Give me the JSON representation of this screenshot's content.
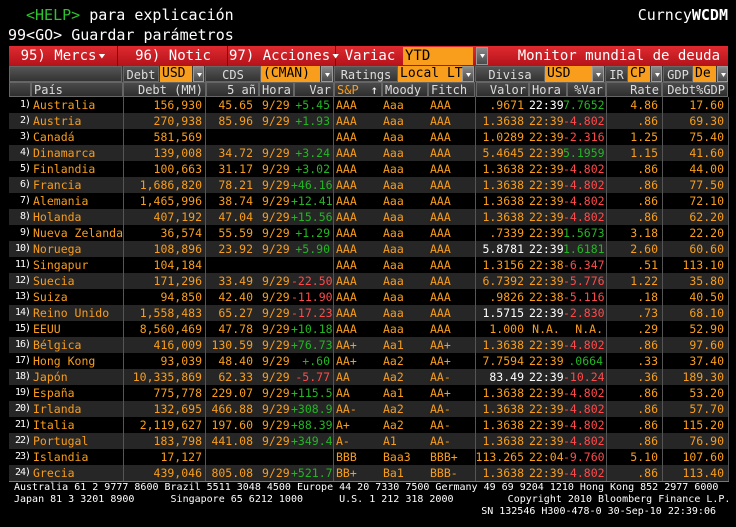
{
  "header": {
    "help_key": "<HELP>",
    "help_text": " para explicación",
    "save_line": "99<GO> Guardar parámetros",
    "function_prefix": "Curncy",
    "function_code": "WCDM"
  },
  "toolbar": {
    "mercs": "95) Mercs",
    "notic": "96) Notic",
    "acciones": "97) Acciones",
    "variac_label": "Variac",
    "variac_value": "YTD",
    "title": "Monitor mundial de deuda"
  },
  "filters": {
    "debt_label": "Debt",
    "debt_value": "USD",
    "cds_label": "CDS",
    "cds_value": "(CMAN)",
    "ratings_label": "Ratings",
    "ratings_value": "Local LT",
    "divisa_label": "Divisa",
    "divisa_value": "USD",
    "ir_label": "IR",
    "ir_value": "CP",
    "gdp_label": "GDP",
    "gdp_value": "De"
  },
  "columns": {
    "pais": "País",
    "debt": "Debt (MM)",
    "cds": "5 añ",
    "hora": "Hora",
    "var": "Var",
    "sp": "S&P",
    "sort_arrow": "↑",
    "moody": "Moody",
    "fitch": "Fitch",
    "valor": "Valor",
    "hora2": "Hora",
    "pvar": "%Var",
    "rate": "Rate",
    "gdp": "Debt%GDP"
  },
  "colors": {
    "orange": "#f99d1c",
    "green": "#22b622",
    "red": "#ff4a4a",
    "white": "#ffffff",
    "accent_red": "#d01c24"
  },
  "rows": [
    {
      "n": "1)",
      "country": "Australia",
      "debt": "156,930",
      "cds": "45.65",
      "hora": "9/29",
      "var": "+5.45",
      "sp": "AAA",
      "moody": "Aaa",
      "fitch": "AAA",
      "valor": ".9671",
      "hora2": "22:39",
      "pvar": "7.7652",
      "rate": "4.86",
      "gdp": "17.60",
      "valor_color": "#f99d1c",
      "hora2_color": "#ffffff"
    },
    {
      "n": "2)",
      "country": "Austria",
      "debt": "270,938",
      "cds": "85.96",
      "hora": "9/29",
      "var": "+1.93",
      "sp": "AAA",
      "moody": "Aaa",
      "fitch": "AAA",
      "valor": "1.3638",
      "hora2": "22:39",
      "pvar": "-4.802",
      "rate": ".86",
      "gdp": "69.30"
    },
    {
      "n": "3)",
      "country": "Canadá",
      "debt": "581,569",
      "cds": "",
      "hora": "",
      "var": "",
      "sp": "AAA",
      "moody": "Aaa",
      "fitch": "AAA",
      "valor": "1.0289",
      "hora2": "22:39",
      "pvar": "-2.316",
      "rate": "1.25",
      "gdp": "75.40"
    },
    {
      "n": "4)",
      "country": "Dinamarca",
      "debt": "139,008",
      "cds": "34.72",
      "hora": "9/29",
      "var": "+3.24",
      "sp": "AAA",
      "moody": "Aaa",
      "fitch": "AAA",
      "valor": "5.4645",
      "hora2": "22:39",
      "pvar": "5.1959",
      "rate": "1.15",
      "gdp": "41.60"
    },
    {
      "n": "5)",
      "country": "Finlandia",
      "debt": "100,663",
      "cds": "31.17",
      "hora": "9/29",
      "var": "+3.02",
      "sp": "AAA",
      "moody": "Aaa",
      "fitch": "AAA",
      "valor": "1.3638",
      "hora2": "22:39",
      "pvar": "-4.802",
      "rate": ".86",
      "gdp": "44.00"
    },
    {
      "n": "6)",
      "country": "Francia",
      "debt": "1,686,820",
      "cds": "78.21",
      "hora": "9/29",
      "var": "+46.16",
      "sp": "AAA",
      "moody": "Aaa",
      "fitch": "AAA",
      "valor": "1.3638",
      "hora2": "22:39",
      "pvar": "-4.802",
      "rate": ".86",
      "gdp": "77.50"
    },
    {
      "n": "7)",
      "country": "Alemania",
      "debt": "1,465,996",
      "cds": "38.74",
      "hora": "9/29",
      "var": "+12.41",
      "sp": "AAA",
      "moody": "Aaa",
      "fitch": "AAA",
      "valor": "1.3638",
      "hora2": "22:39",
      "pvar": "-4.802",
      "rate": ".86",
      "gdp": "72.10"
    },
    {
      "n": "8)",
      "country": "Holanda",
      "debt": "407,192",
      "cds": "47.04",
      "hora": "9/29",
      "var": "+15.56",
      "sp": "AAA",
      "moody": "Aaa",
      "fitch": "AAA",
      "valor": "1.3638",
      "hora2": "22:39",
      "pvar": "-4.802",
      "rate": ".86",
      "gdp": "62.20"
    },
    {
      "n": "9)",
      "country": "Nueva Zelanda",
      "debt": "36,574",
      "cds": "55.59",
      "hora": "9/29",
      "var": "+1.29",
      "sp": "AAA",
      "moody": "Aaa",
      "fitch": "AAA",
      "valor": ".7339",
      "hora2": "22:39",
      "pvar": "1.5673",
      "rate": "3.18",
      "gdp": "22.20"
    },
    {
      "n": "10)",
      "country": "Noruega",
      "debt": "108,896",
      "cds": "23.92",
      "hora": "9/29",
      "var": "+5.90",
      "sp": "AAA",
      "moody": "Aaa",
      "fitch": "AAA",
      "valor": "5.8781",
      "hora2": "22:39",
      "pvar": "1.6181",
      "rate": "2.60",
      "gdp": "60.60",
      "valor_color": "#ffffff",
      "hora2_color": "#ffffff"
    },
    {
      "n": "11)",
      "country": "Singapur",
      "debt": "104,184",
      "cds": "",
      "hora": "",
      "var": "",
      "sp": "AAA",
      "moody": "Aaa",
      "fitch": "AAA",
      "valor": "1.3156",
      "hora2": "22:38",
      "pvar": "-6.347",
      "rate": ".51",
      "gdp": "113.10"
    },
    {
      "n": "12)",
      "country": "Suecia",
      "debt": "171,296",
      "cds": "33.49",
      "hora": "9/29",
      "var": "-22.50",
      "sp": "AAA",
      "moody": "Aaa",
      "fitch": "AAA",
      "valor": "6.7392",
      "hora2": "22:39",
      "pvar": "-5.776",
      "rate": "1.22",
      "gdp": "35.80"
    },
    {
      "n": "13)",
      "country": "Suiza",
      "debt": "94,850",
      "cds": "42.40",
      "hora": "9/29",
      "var": "-11.90",
      "sp": "AAA",
      "moody": "Aaa",
      "fitch": "AAA",
      "valor": ".9826",
      "hora2": "22:38",
      "pvar": "-5.116",
      "rate": ".18",
      "gdp": "40.50"
    },
    {
      "n": "14)",
      "country": "Reino Unido",
      "debt": "1,558,483",
      "cds": "65.27",
      "hora": "9/29",
      "var": "-17.23",
      "sp": "AAA",
      "moody": "Aaa",
      "fitch": "AAA",
      "valor": "1.5715",
      "hora2": "22:39",
      "pvar": "-2.830",
      "rate": ".73",
      "gdp": "68.10",
      "valor_color": "#ffffff",
      "hora2_color": "#ffffff"
    },
    {
      "n": "15)",
      "country": "EEUU",
      "debt": "8,560,469",
      "cds": "47.78",
      "hora": "9/29",
      "var": "+10.18",
      "sp": "AAA",
      "moody": "Aaa",
      "fitch": "AAA",
      "valor": "1.000",
      "hora2": "N.A.",
      "pvar": "N.A.",
      "rate": ".29",
      "gdp": "52.90"
    },
    {
      "n": "16)",
      "country": "Bélgica",
      "debt": "416,009",
      "cds": "130.59",
      "hora": "9/29",
      "var": "+76.73",
      "sp": "AA+",
      "moody": "Aa1",
      "fitch": "AA+",
      "valor": "1.3638",
      "hora2": "22:39",
      "pvar": "-4.802",
      "rate": ".86",
      "gdp": "97.60"
    },
    {
      "n": "17)",
      "country": "Hong Kong",
      "debt": "93,039",
      "cds": "48.40",
      "hora": "9/29",
      "var": "+.60",
      "sp": "AA+",
      "moody": "Aa2",
      "fitch": "AA+",
      "valor": "7.7594",
      "hora2": "22:39",
      "pvar": ".0664",
      "rate": ".33",
      "gdp": "37.40"
    },
    {
      "n": "18)",
      "country": "Japón",
      "debt": "10,335,869",
      "cds": "62.33",
      "hora": "9/29",
      "var": "-5.77",
      "sp": "AA",
      "moody": "Aa2",
      "fitch": "AA-",
      "valor": "83.49",
      "hora2": "22:39",
      "pvar": "-10.24",
      "rate": ".36",
      "gdp": "189.30",
      "valor_color": "#ffffff",
      "hora2_color": "#ffffff"
    },
    {
      "n": "19)",
      "country": "España",
      "debt": "775,778",
      "cds": "229.07",
      "hora": "9/29",
      "var": "+115.5",
      "sp": "AA",
      "moody": "Aa1",
      "fitch": "AA+",
      "valor": "1.3638",
      "hora2": "22:39",
      "pvar": "-4.802",
      "rate": ".86",
      "gdp": "53.20"
    },
    {
      "n": "20)",
      "country": "Irlanda",
      "debt": "132,695",
      "cds": "466.88",
      "hora": "9/29",
      "var": "+308.9",
      "sp": "AA-",
      "moody": "Aa2",
      "fitch": "AA-",
      "valor": "1.3638",
      "hora2": "22:39",
      "pvar": "-4.802",
      "rate": ".86",
      "gdp": "57.70"
    },
    {
      "n": "21)",
      "country": "Italia",
      "debt": "2,119,627",
      "cds": "197.60",
      "hora": "9/29",
      "var": "+88.39",
      "sp": "A+",
      "moody": "Aa2",
      "fitch": "AA-",
      "valor": "1.3638",
      "hora2": "22:39",
      "pvar": "-4.802",
      "rate": ".86",
      "gdp": "115.20"
    },
    {
      "n": "22)",
      "country": "Portugal",
      "debt": "183,798",
      "cds": "441.08",
      "hora": "9/29",
      "var": "+349.4",
      "sp": "A-",
      "moody": "A1",
      "fitch": "AA-",
      "valor": "1.3638",
      "hora2": "22:39",
      "pvar": "-4.802",
      "rate": ".86",
      "gdp": "76.90"
    },
    {
      "n": "23)",
      "country": "Islandia",
      "debt": "17,127",
      "cds": "",
      "hora": "",
      "var": "",
      "sp": "BBB",
      "moody": "Baa3",
      "fitch": "BBB+",
      "valor": "113.265",
      "hora2": "22:04",
      "pvar": "-9.760",
      "rate": "5.10",
      "gdp": "107.60"
    },
    {
      "n": "24)",
      "country": "Grecia",
      "debt": "439,046",
      "cds": "805.08",
      "hora": "9/29",
      "var": "+521.7",
      "sp": "BB+",
      "moody": "Ba1",
      "fitch": "BBB-",
      "valor": "1.3638",
      "hora2": "22:39",
      "pvar": "-4.802",
      "rate": ".86",
      "gdp": "113.40"
    }
  ],
  "footer": {
    "line1": "Australia 61 2 9777 8600 Brazil 5511 3048 4500 Europe 44 20 7330 7500 Germany 49 69 9204 1210 Hong Kong 852 2977 6000",
    "line2": "Japan 81 3 3201 8900      Singapore 65 6212 1000      U.S. 1 212 318 2000         Copyright 2010 Bloomberg Finance L.P.",
    "line3": "SN 132546 H300-478-0 30-Sep-10 22:39:06"
  }
}
